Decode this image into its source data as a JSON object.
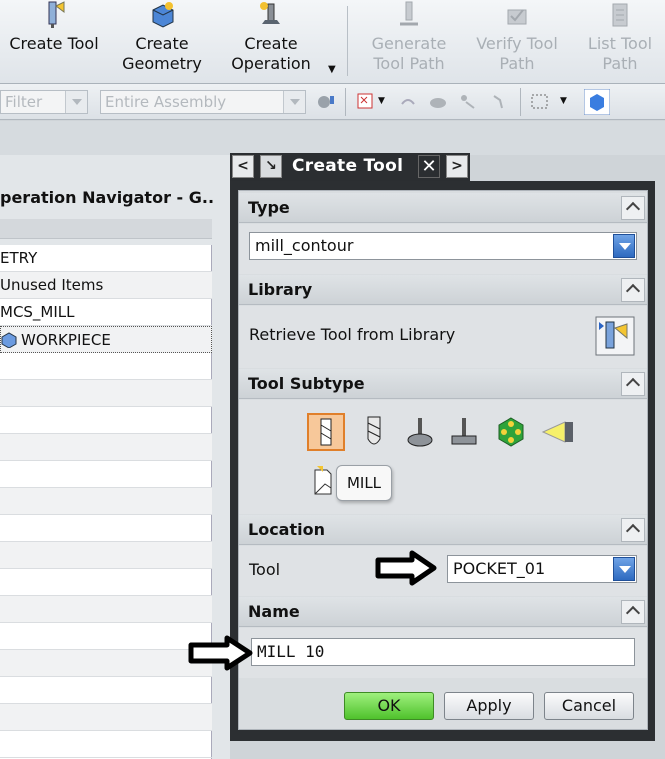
{
  "ribbon": {
    "buttons": [
      {
        "label": "Create Tool",
        "icon": "create-tool-icon",
        "enabled": true
      },
      {
        "label": "Create Geometry",
        "icon": "create-geometry-icon",
        "enabled": true
      },
      {
        "label": "Create Operation",
        "icon": "create-operation-icon",
        "enabled": true
      },
      {
        "label": "Generate Tool Path",
        "icon": "generate-toolpath-icon",
        "enabled": false
      },
      {
        "label": "Verify Tool Path",
        "icon": "verify-toolpath-icon",
        "enabled": false
      },
      {
        "label": "List Tool Path",
        "icon": "list-toolpath-icon",
        "enabled": false
      }
    ],
    "label_lines": {
      "create_tool": "Create Tool",
      "create_geometry_1": "Create",
      "create_geometry_2": "Geometry",
      "create_operation_1": "Create",
      "create_operation_2": "Operation",
      "generate_1": "Generate",
      "generate_2": "Tool Path",
      "verify_1": "Verify Tool",
      "verify_2": "Path",
      "list_1": "List Tool",
      "list_2": "Path"
    }
  },
  "toolbar": {
    "filter_placeholder": "Filter",
    "assembly_value": "Entire Assembly"
  },
  "navigator": {
    "title": "peration Navigator - G...",
    "rows": [
      "ETRY",
      "Unused Items",
      "MCS_MILL",
      "WORKPIECE"
    ]
  },
  "dialog": {
    "title": "Create Tool",
    "type": {
      "heading": "Type",
      "value": "mill_contour"
    },
    "library": {
      "heading": "Library",
      "retrieve_label": "Retrieve Tool from Library"
    },
    "subtype": {
      "heading": "Tool Subtype",
      "tooltip": "MILL"
    },
    "location": {
      "heading": "Location",
      "tool_label": "Tool",
      "tool_value": "POCKET_01"
    },
    "name": {
      "heading": "Name",
      "value": "MILL 10"
    },
    "buttons": {
      "ok": "OK",
      "apply": "Apply",
      "cancel": "Cancel"
    }
  },
  "colors": {
    "ok_button": "#5ccc36",
    "dropdown_blue": "#2e6ac0",
    "title_bar": "#2b2e31"
  }
}
